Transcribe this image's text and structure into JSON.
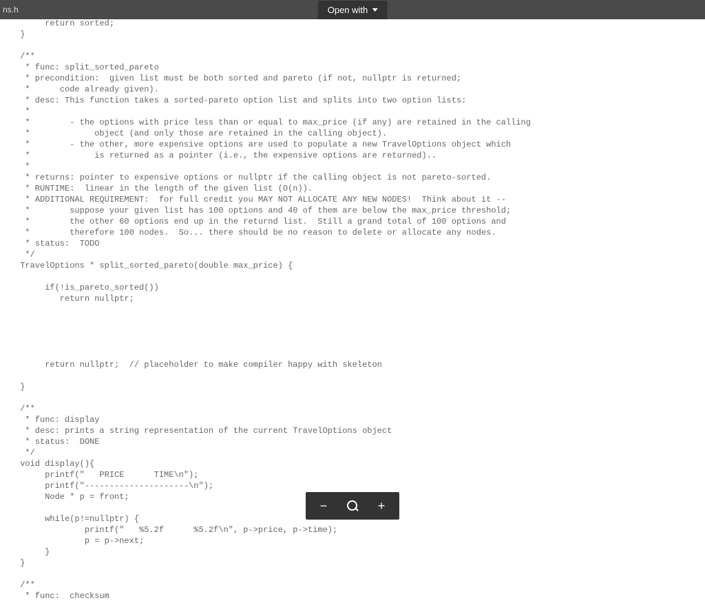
{
  "toolbar": {
    "filename": "ns.h",
    "open_with_label": "Open with"
  },
  "code_lines": [
    "      return sorted;",
    " }",
    "",
    " /**",
    "  * func: split_sorted_pareto",
    "  * precondition:  given list must be both sorted and pareto (if not, nullptr is returned;",
    "  *      code already given).",
    "  * desc: This function takes a sorted-pareto option list and splits into two option lists:",
    "  *",
    "  *        - the options with price less than or equal to max_price (if any) are retained in the calling",
    "  *             object (and only those are retained in the calling object).",
    "  *        - the other, more expensive options are used to populate a new TravelOptions object which",
    "  *             is returned as a pointer (i.e., the expensive options are returned)..",
    "  *",
    "  * returns: pointer to expensive options or nullptr if the calling object is not pareto-sorted.",
    "  * RUNTIME:  linear in the length of the given list (O(n)).",
    "  * ADDITIONAL REQUIREMENT:  for full credit you MAY NOT ALLOCATE ANY NEW NODES!  Think about it --",
    "  *        suppose your given list has 100 options and 40 of them are below the max_price threshold;",
    "  *        the other 60 options end up in the returnd list.  Still a grand total of 100 options and",
    "  *        therefore 100 nodes.  So... there should be no reason to delete or allocate any nodes.",
    "  * status:  TODO",
    "  */",
    " TravelOptions * split_sorted_pareto(double max_price) {",
    "",
    "      if(!is_pareto_sorted())",
    "         return nullptr;",
    "",
    "",
    "",
    "",
    "",
    "      return nullptr;  // placeholder to make compiler happy with skeleton",
    "",
    " }",
    "",
    " /**",
    "  * func: display",
    "  * desc: prints a string representation of the current TravelOptions object",
    "  * status:  DONE",
    "  */",
    " void display(){",
    "      printf(\"   PRICE      TIME\\n\");",
    "      printf(\"---------------------\\n\");",
    "      Node * p = front;",
    "",
    "      while(p!=nullptr) {",
    "              printf(\"   %5.2f      %5.2f\\n\", p->price, p->time);",
    "              p = p->next;",
    "      }",
    " }",
    "",
    " /**",
    "  * func:  checksum"
  ],
  "bottom_bar": {
    "zoom_out": "−",
    "zoom_in": "+"
  }
}
